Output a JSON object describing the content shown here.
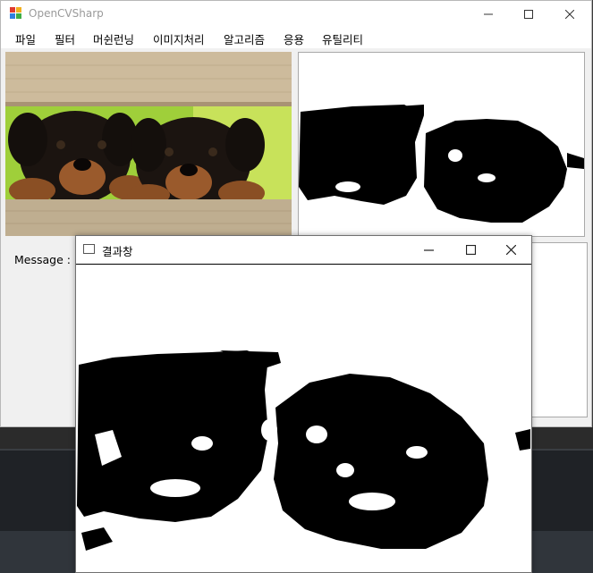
{
  "main_window": {
    "title": "OpenCVSharp",
    "controls": {
      "minimize": "minimize-icon",
      "maximize": "maximize-icon",
      "close": "close-icon"
    }
  },
  "menu": {
    "items": [
      "파일",
      "필터",
      "머쉰런닝",
      "이미지처리",
      "알고리즘",
      "응용",
      "유틸리티"
    ]
  },
  "source_image": {
    "subject": "two puppies looking over a wooden fence",
    "icon": "photo"
  },
  "message_label": "Message :",
  "result_window": {
    "title": "결과창",
    "controls": {
      "minimize": "minimize-icon",
      "maximize": "maximize-icon",
      "close": "close-icon"
    }
  },
  "colors": {
    "window_bg": "#f0f0f0",
    "title_text": "#9a9a9a",
    "desktop": "#2b2b2b"
  }
}
